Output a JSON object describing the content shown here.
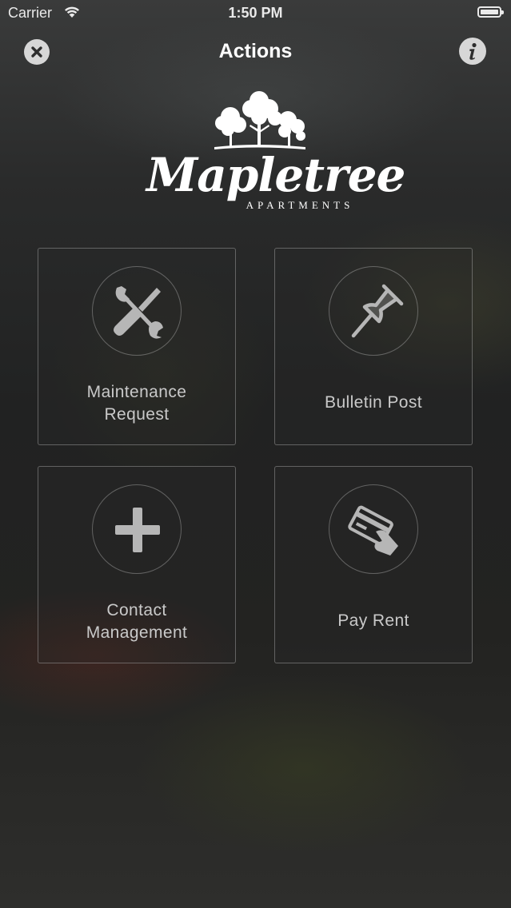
{
  "status_bar": {
    "carrier": "Carrier",
    "time": "1:50 PM",
    "wifi_icon": "wifi-icon",
    "battery_icon": "battery-full-icon"
  },
  "nav": {
    "title": "Actions",
    "close_icon": "close-icon",
    "info_icon": "info-icon"
  },
  "logo": {
    "name": "Mapletree",
    "subtitle": "APARTMENTS",
    "icon": "trees-icon"
  },
  "actions": [
    {
      "label_line1": "Maintenance",
      "label_line2": "Request",
      "icon": "tools-icon"
    },
    {
      "label_line1": "Bulletin Post",
      "icon": "pushpin-icon"
    },
    {
      "label_line1": "Contact",
      "label_line2": "Management",
      "icon": "plus-icon"
    },
    {
      "label_line1": "Pay Rent",
      "icon": "credit-card-icon"
    }
  ],
  "colors": {
    "background": "#232423",
    "tile_border": "#8a8a8a",
    "label_text": "#c9c9c9",
    "icon_fill": "#b4b4b4",
    "title_text": "#ffffff"
  }
}
